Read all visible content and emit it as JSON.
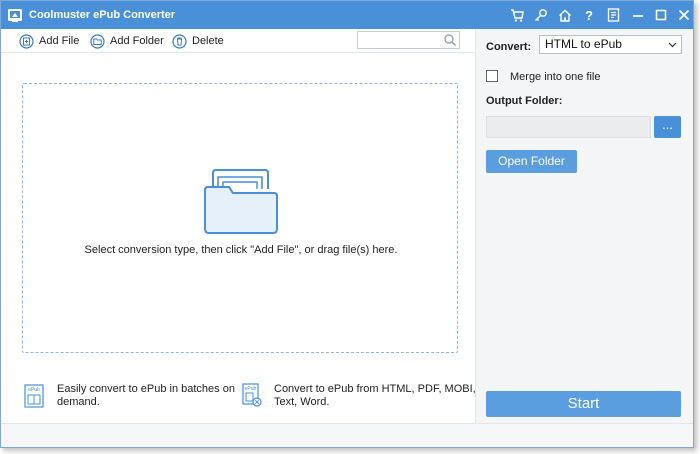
{
  "titlebar": {
    "title": "Coolmuster ePub Converter",
    "icons": [
      "cart-icon",
      "key-icon",
      "home-icon",
      "help-icon",
      "feedback-icon",
      "minimize-icon",
      "maximize-icon",
      "close-icon"
    ],
    "help_glyph": "?"
  },
  "toolbar": {
    "add_file": "Add File",
    "add_folder": "Add Folder",
    "delete": "Delete",
    "search_placeholder": ""
  },
  "drop_zone": {
    "hint": "Select conversion type, then click \"Add File\", or drag file(s) here."
  },
  "features": [
    {
      "icon": "epub-book-icon",
      "badge": "ePub",
      "text_line1": "Easily convert to ePub in batches on",
      "text_line2": "demand."
    },
    {
      "icon": "epub-convert-icon",
      "badge": "ePub",
      "text_line1": "Convert to ePub from HTML, PDF, MOBI,",
      "text_line2": "Text, Word."
    }
  ],
  "settings": {
    "convert_label": "Convert:",
    "convert_value": "HTML to ePub",
    "merge_label": "Merge into one file",
    "merge_checked": false,
    "output_folder_label": "Output Folder:",
    "output_folder_value": "",
    "browse_label": "...",
    "open_folder": "Open Folder",
    "start": "Start"
  },
  "colors": {
    "accent": "#4a90d9",
    "button": "#5b9ee0",
    "panel": "#f4f5f7"
  }
}
